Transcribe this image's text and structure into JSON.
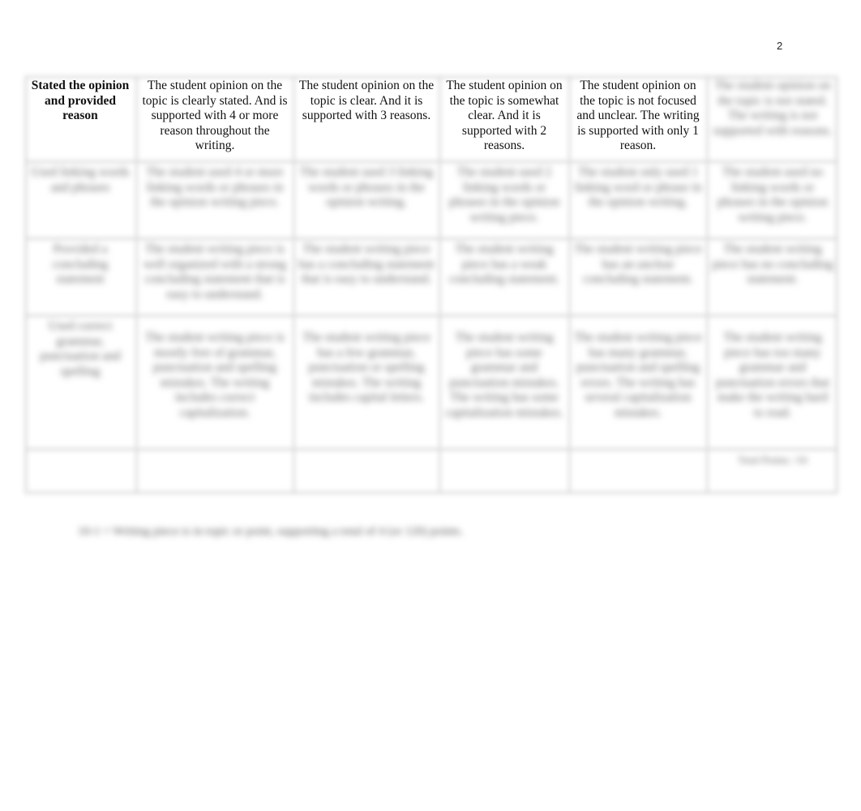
{
  "page": {
    "page_number": "2"
  },
  "rubric": {
    "rows": [
      {
        "criterion": "Stated the opinion and provided reason",
        "levels": [
          "The student opinion on the topic is clearly stated. And is supported with 4 or more reason throughout the writing.",
          "The student opinion on the topic is clear. And it is supported with 3 reasons.",
          "The student opinion on the topic is somewhat clear. And it is supported with 2 reasons.",
          "The student opinion on the topic is not focused and unclear. The writing is supported with only 1 reason.",
          "The student opinion on the topic is not stated. The writing is not supported with reasons."
        ],
        "obscured": [
          false,
          false,
          false,
          false,
          false,
          true
        ]
      },
      {
        "criterion": "Used linking words and phrases",
        "levels": [
          "The student used 4 or more linking words or phrases in the opinion writing piece.",
          "The student used 3 linking words or phrases in the opinion writing.",
          "The student used 2 linking words or phrases in the opinion writing piece.",
          "The student only used 1 linking word or phrase in the opinion writing.",
          "The student used no linking words or phrases in the opinion writing piece."
        ],
        "obscured": true
      },
      {
        "criterion": "Provided a concluding statement",
        "levels": [
          "The student writing piece is well organized with a strong concluding statement that is easy to understand.",
          "The student writing piece has a concluding statement that is easy to understand.",
          "The student writing piece has a weak concluding statement.",
          "The student writing piece has an unclear concluding statement.",
          "The student writing piece has no concluding statement."
        ],
        "obscured": true
      },
      {
        "criterion": "Used correct grammar, punctuation and spelling",
        "levels": [
          "The student writing piece is mostly free of grammar, punctuation and spelling mistakes. The writing includes correct capitalization.",
          "The student writing piece has a few grammar, punctuation or spelling mistakes. The writing includes capital letters.",
          "The student writing piece has some grammar and punctuation mistakes. The writing has some capitalization mistakes.",
          "The student writing piece has many grammar, punctuation and spelling errors. The writing has several capitalization mistakes.",
          "The student writing piece has too many grammar and punctuation errors that make the writing hard to read."
        ],
        "obscured": true
      },
      {
        "criterion": "",
        "levels": [
          "",
          "",
          "",
          "",
          "Total Points: /16"
        ],
        "obscured": true
      }
    ]
  },
  "footnote": "10-1 = Writing piece is in topic or point, supporting a total of 4 (or 120) points."
}
